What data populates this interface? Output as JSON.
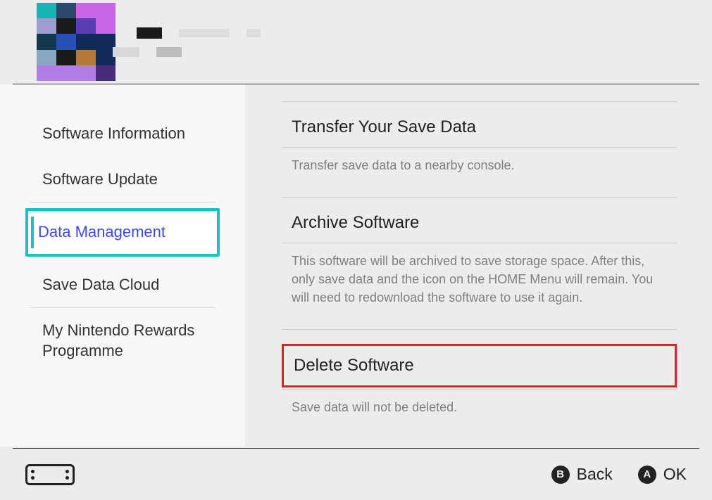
{
  "sidebar": {
    "items": [
      {
        "label": "Software Information"
      },
      {
        "label": "Software Update"
      },
      {
        "label": "Data Management"
      },
      {
        "label": "Save Data Cloud"
      },
      {
        "label": "My Nintendo Rewards Programme"
      }
    ],
    "selected_index": 2
  },
  "options": [
    {
      "title": "Transfer Your Save Data",
      "description": "Transfer save data to a nearby console."
    },
    {
      "title": "Archive Software",
      "description": "This software will be archived to save storage space. After this, only save data and the icon on the HOME Menu will remain. You will need to redownload the software to use it again."
    },
    {
      "title": "Delete Software",
      "description": "Save data will not be deleted.",
      "highlighted": true
    }
  ],
  "footer": {
    "back": {
      "button": "B",
      "label": "Back"
    },
    "ok": {
      "button": "A",
      "label": "OK"
    }
  },
  "icon_colors": [
    "#14b5b5",
    "#2b4a6b",
    "#c766e6",
    "#c766e6",
    "#9f9fcf",
    "#1a1a1a",
    "#5a3db5",
    "#c766e6",
    "#13394f",
    "#2951b5",
    "#142a5a",
    "#142a5a",
    "#89a6c2",
    "#1a1a1a",
    "#b57a3a",
    "#142a5a",
    "#b27de6",
    "#b27de6",
    "#b27de6",
    "#4a2a7a"
  ]
}
